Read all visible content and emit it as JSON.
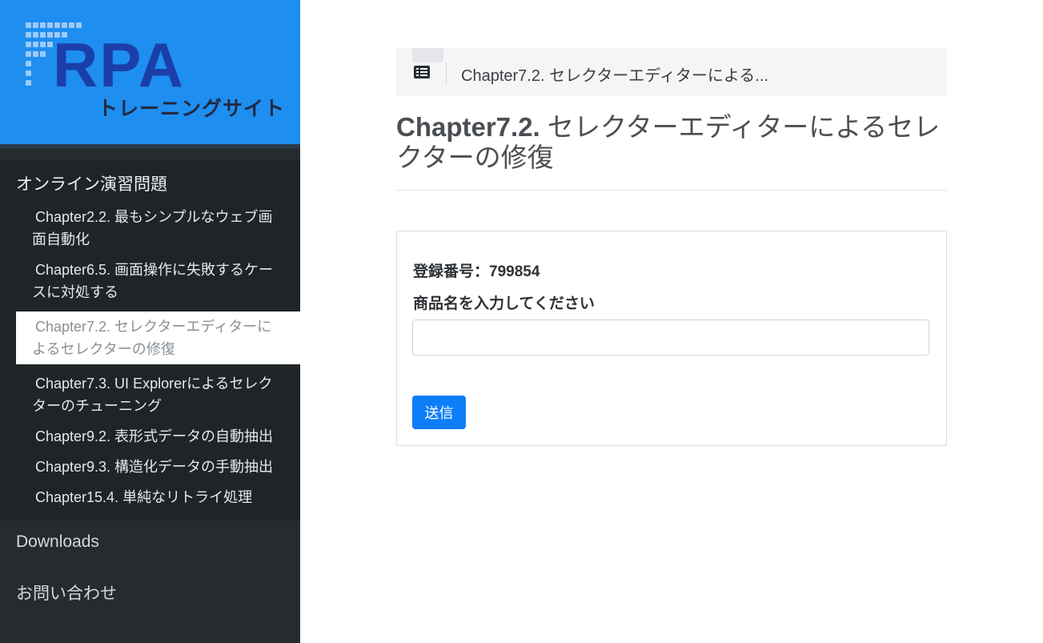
{
  "brand": {
    "logo_main": "RPA",
    "logo_sub": "トレーニングサイト",
    "colors": {
      "header_bg": "#1e8ef0",
      "logo_text": "#1b3fa9"
    }
  },
  "sidebar": {
    "section_title": "オンライン演習問題",
    "items": [
      {
        "label": "Chapter2.2. 最もシンプルなウェブ画面自動化",
        "active": false
      },
      {
        "label": "Chapter6.5. 画面操作に失敗するケースに対処する",
        "active": false
      },
      {
        "label": "Chapter7.2. セレクターエディターによるセレクターの修復",
        "active": true
      },
      {
        "label": "Chapter7.3. UI Explorerによるセレクターのチューニング",
        "active": false
      },
      {
        "label": "Chapter9.2. 表形式データの自動抽出",
        "active": false
      },
      {
        "label": "Chapter9.3. 構造化データの手動抽出",
        "active": false
      },
      {
        "label": "Chapter15.4. 単純なリトライ処理",
        "active": false
      }
    ],
    "downloads_label": "Downloads",
    "contact_label": "お問い合わせ"
  },
  "breadcrumb": {
    "icon": "list-icon",
    "text": "Chapter7.2. セレクターエディターによる..."
  },
  "page": {
    "title_chapter": "Chapter7.2.",
    "title_rest": " セレクターエディターによるセレクターの修復"
  },
  "form": {
    "registration": "登録番号：799854",
    "product_label": "商品名を入力してください",
    "product_value": "",
    "submit_label": "送信",
    "accent": "#0d7ef8"
  }
}
